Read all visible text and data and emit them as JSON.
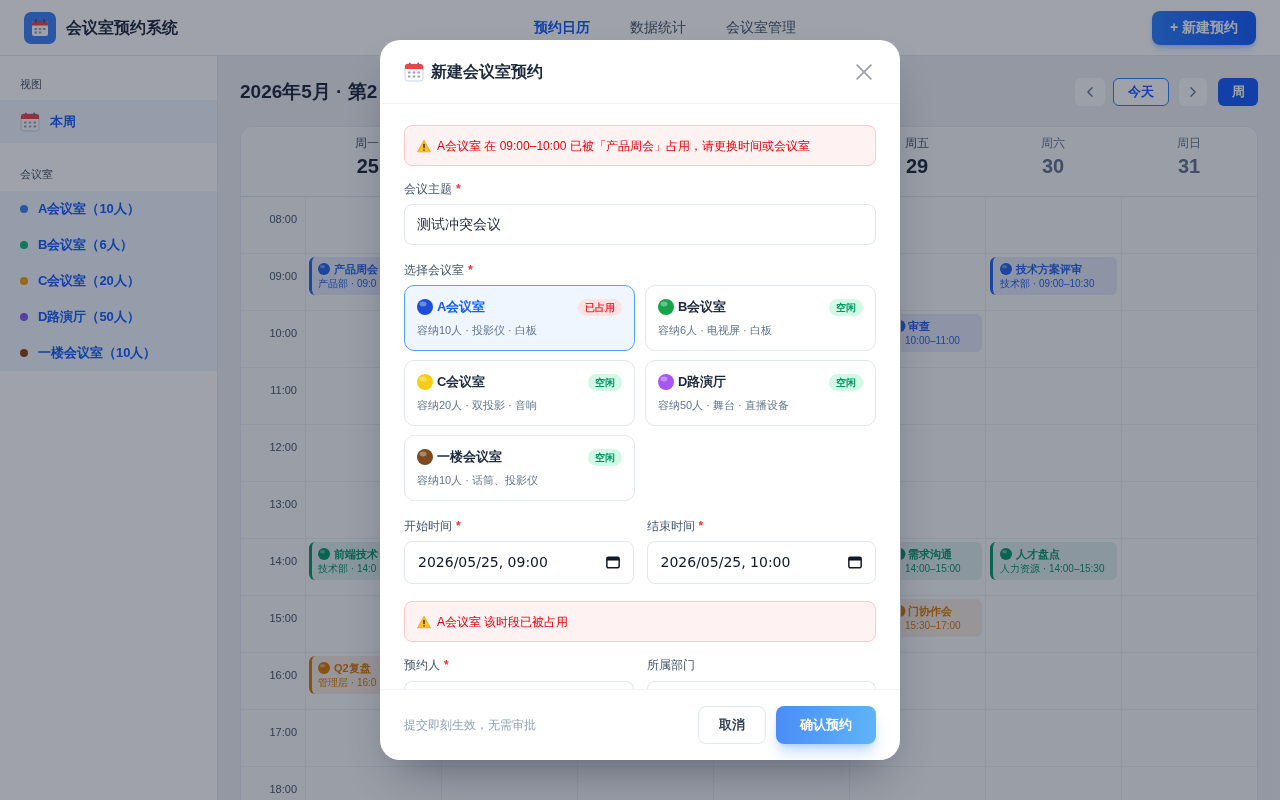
{
  "app": {
    "title": "会议室预约系统",
    "nav": [
      {
        "label": "预约日历",
        "selected": true
      },
      {
        "label": "数据统计",
        "selected": false
      },
      {
        "label": "会议室管理",
        "selected": false
      }
    ],
    "new_button": "+ 新建预约"
  },
  "sidebar": {
    "sections": [
      {
        "title": "视图",
        "items": [
          {
            "kind": "view",
            "label": "本周",
            "selected": true
          }
        ]
      },
      {
        "title": "会议室",
        "items": [
          {
            "kind": "room",
            "label": "A会议室（10人）",
            "color": "#2957a4",
            "selected": true
          },
          {
            "kind": "room",
            "label": "B会议室（6人）",
            "color": "#10785e",
            "selected": true
          },
          {
            "kind": "room",
            "label": "C会议室（20人）",
            "color": "#996817",
            "selected": true
          },
          {
            "kind": "room",
            "label": "D路演厅（50人）",
            "color": "#5940a4",
            "selected": true
          },
          {
            "kind": "room",
            "label": "一楼会议室（10人）",
            "color": "#5e3019",
            "selected": true
          }
        ]
      }
    ]
  },
  "calendar": {
    "title": "2026年5月 · 第2",
    "today_button": "今天",
    "view_modes": [
      {
        "label": "周",
        "selected": true
      }
    ],
    "days": [
      {
        "weekday": "周一",
        "date": "25",
        "weekend": false
      },
      {
        "weekday": "周五",
        "date": "29",
        "weekend": false
      },
      {
        "weekday": "周六",
        "date": "30",
        "weekend": true
      },
      {
        "weekday": "周日",
        "date": "31",
        "weekend": true
      }
    ],
    "rows": [
      {
        "time": "08:00",
        "cells": [
          null,
          null,
          null,
          null
        ]
      },
      {
        "time": "09:00",
        "cells": [
          {
            "title": "产品周会",
            "details": "产品部 · 09:0",
            "color": "#1c459e"
          },
          null,
          {
            "title": "技术方案评审",
            "details": "技术部 · 09:00–10:30",
            "color": "#1c459e"
          },
          null
        ]
      },
      {
        "time": "10:00",
        "cells": [
          null,
          {
            "title": "审查",
            "details": "10:00–11:00",
            "color": "#1c459e"
          },
          null,
          null
        ]
      },
      {
        "time": "11:00",
        "cells": [
          null,
          null,
          null,
          null
        ]
      },
      {
        "time": "12:00",
        "cells": [
          null,
          null,
          null,
          null
        ]
      },
      {
        "time": "13:00",
        "cells": [
          null,
          null,
          null,
          null
        ]
      },
      {
        "time": "14:00",
        "cells": [
          {
            "title": "前端技术",
            "details": "技术部 · 14:0",
            "color": "#096350"
          },
          {
            "title": "需求沟通",
            "details": "14:00–15:00",
            "color": "#096350"
          },
          {
            "title": "人才盘点",
            "details": "人力资源 · 14:00–15:30",
            "color": "#096350"
          },
          null
        ]
      },
      {
        "time": "15:00",
        "cells": [
          null,
          {
            "title": "门协作会",
            "details": "15:30–17:00",
            "color": "#885114"
          },
          null,
          null
        ]
      },
      {
        "time": "16:00",
        "cells": [
          {
            "title": "Q2复盘",
            "details": "管理层 · 16:0",
            "color": "#885114"
          },
          null,
          null,
          null
        ]
      },
      {
        "time": "17:00",
        "cells": [
          null,
          null,
          null,
          null
        ]
      },
      {
        "time": "18:00",
        "cells": [
          null,
          null,
          null,
          null
        ]
      }
    ]
  },
  "modal": {
    "title": "新建会议室预约",
    "conflict_alert": "A会议室 在 09:00–10:00 已被「产品周会」占用，请更换时间或会议室",
    "subject": {
      "label": "会议主题",
      "required_mark": "*",
      "value": "测试冲突会议"
    },
    "room_picker": {
      "label": "选择会议室",
      "required_mark": "*",
      "options": [
        {
          "name": "A会议室",
          "details": "容纳10人 · 投影仪 · 白板",
          "status": "已占用",
          "occupied": true,
          "selected": true,
          "color": "#1d4ed8"
        },
        {
          "name": "B会议室",
          "details": "容纳6人 · 电视屏 · 白板",
          "status": "空闲",
          "occupied": false,
          "selected": false,
          "color": "#16a34a"
        },
        {
          "name": "C会议室",
          "details": "容纳20人 · 双投影 · 音响",
          "status": "空闲",
          "occupied": false,
          "selected": false,
          "color": "#facc15"
        },
        {
          "name": "D路演厅",
          "details": "容纳50人 · 舞台 · 直播设备",
          "status": "空闲",
          "occupied": false,
          "selected": false,
          "color": "#a855f7"
        },
        {
          "name": "一楼会议室",
          "details": "容纳10人 · 话筒、投影仪",
          "status": "空闲",
          "occupied": false,
          "selected": false,
          "color": "#7c4a1e"
        }
      ]
    },
    "start_time": {
      "label": "开始时间",
      "required_mark": "*",
      "value": "2026/05/25, 09:00"
    },
    "end_time": {
      "label": "结束时间",
      "required_mark": "*",
      "value": "2026/05/25, 10:00"
    },
    "time_alert": "A会议室 该时段已被占用",
    "booker": {
      "label": "预约人",
      "required_mark": "*"
    },
    "department": {
      "label": "所属部门"
    },
    "footer": {
      "hint": "提交即刻生效，无需审批",
      "cancel": "取消",
      "confirm": "确认预约"
    }
  }
}
